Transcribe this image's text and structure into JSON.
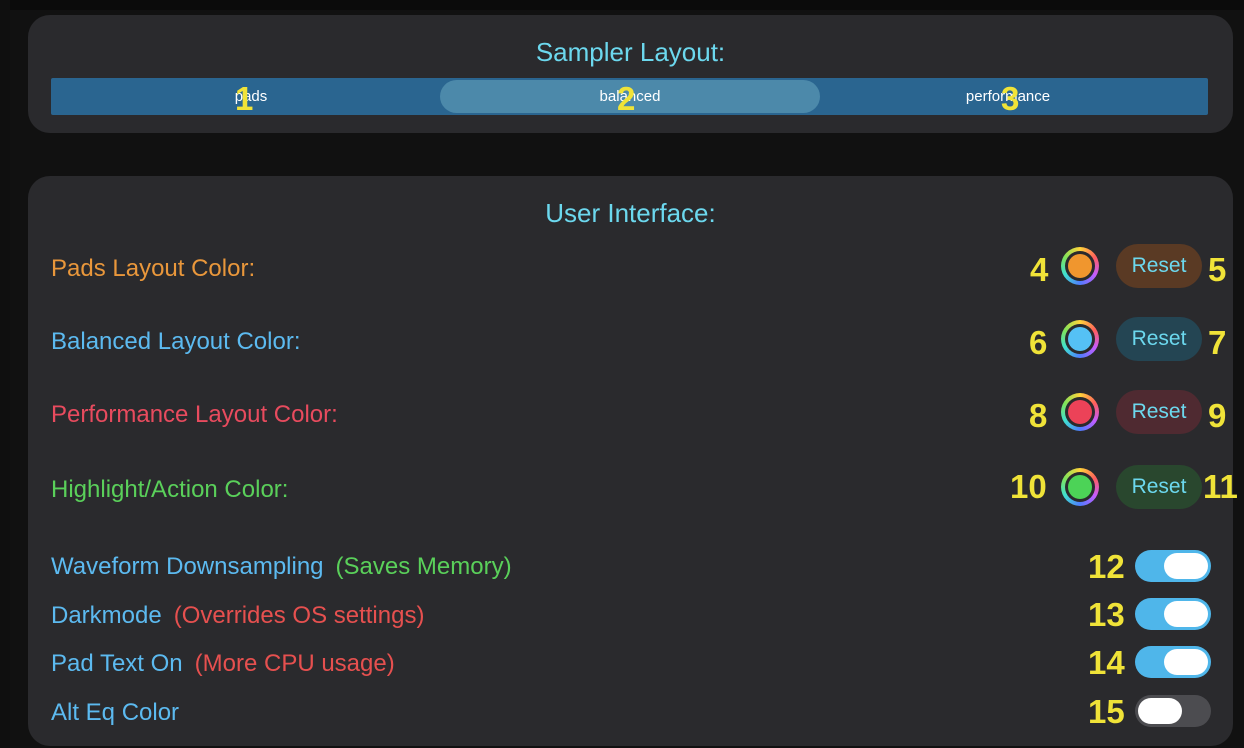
{
  "sampler_layout": {
    "title": "Sampler Layout:",
    "segments": [
      {
        "label": "pads",
        "annotation": "1"
      },
      {
        "label": "balanced",
        "annotation": "2"
      },
      {
        "label": "performance",
        "annotation": "3"
      }
    ],
    "selected_segment": "balanced"
  },
  "user_interface": {
    "title": "User Interface:",
    "color_rows": [
      {
        "label": "Pads Layout Color:",
        "label_color": "#e9973b",
        "swatch_color": "#f0962e",
        "swatch_annotation": "4",
        "reset_label": "Reset",
        "reset_bg": "#5a3a24",
        "reset_annotation": "5"
      },
      {
        "label": "Balanced Layout Color:",
        "label_color": "#5cbaf0",
        "swatch_color": "#55c1f5",
        "swatch_annotation": "6",
        "reset_label": "Reset",
        "reset_bg": "#244553",
        "reset_annotation": "7"
      },
      {
        "label": "Performance Layout Color:",
        "label_color": "#e84b5e",
        "swatch_color": "#ec4258",
        "swatch_annotation": "8",
        "reset_label": "Reset",
        "reset_bg": "#4f2a31",
        "reset_annotation": "9"
      },
      {
        "label": "Highlight/Action Color:",
        "label_color": "#5ad05a",
        "swatch_color": "#4cd357",
        "swatch_annotation": "10",
        "reset_label": "Reset",
        "reset_bg": "#29472e",
        "reset_annotation": "11"
      }
    ],
    "toggles": [
      {
        "label": "Waveform Downsampling",
        "note": "(Saves Memory)",
        "note_color": "#5ad05a",
        "on": true,
        "annotation": "12"
      },
      {
        "label": "Darkmode",
        "note": "(Overrides OS settings)",
        "note_color": "#e6504f",
        "on": true,
        "annotation": "13"
      },
      {
        "label": "Pad Text On",
        "note": "(More CPU usage)",
        "note_color": "#e6504f",
        "on": true,
        "annotation": "14"
      },
      {
        "label": "Alt Eq Color",
        "note": "",
        "note_color": "",
        "on": false,
        "annotation": "15"
      }
    ]
  },
  "colors": {
    "accent_cyan": "#6cd8ee",
    "label_blue": "#5cbaf0",
    "annotation_yellow": "#f0e338",
    "panel_bg": "#2a2a2d",
    "segment_bg": "#2a6590",
    "segment_selected": "#4c89aa"
  }
}
